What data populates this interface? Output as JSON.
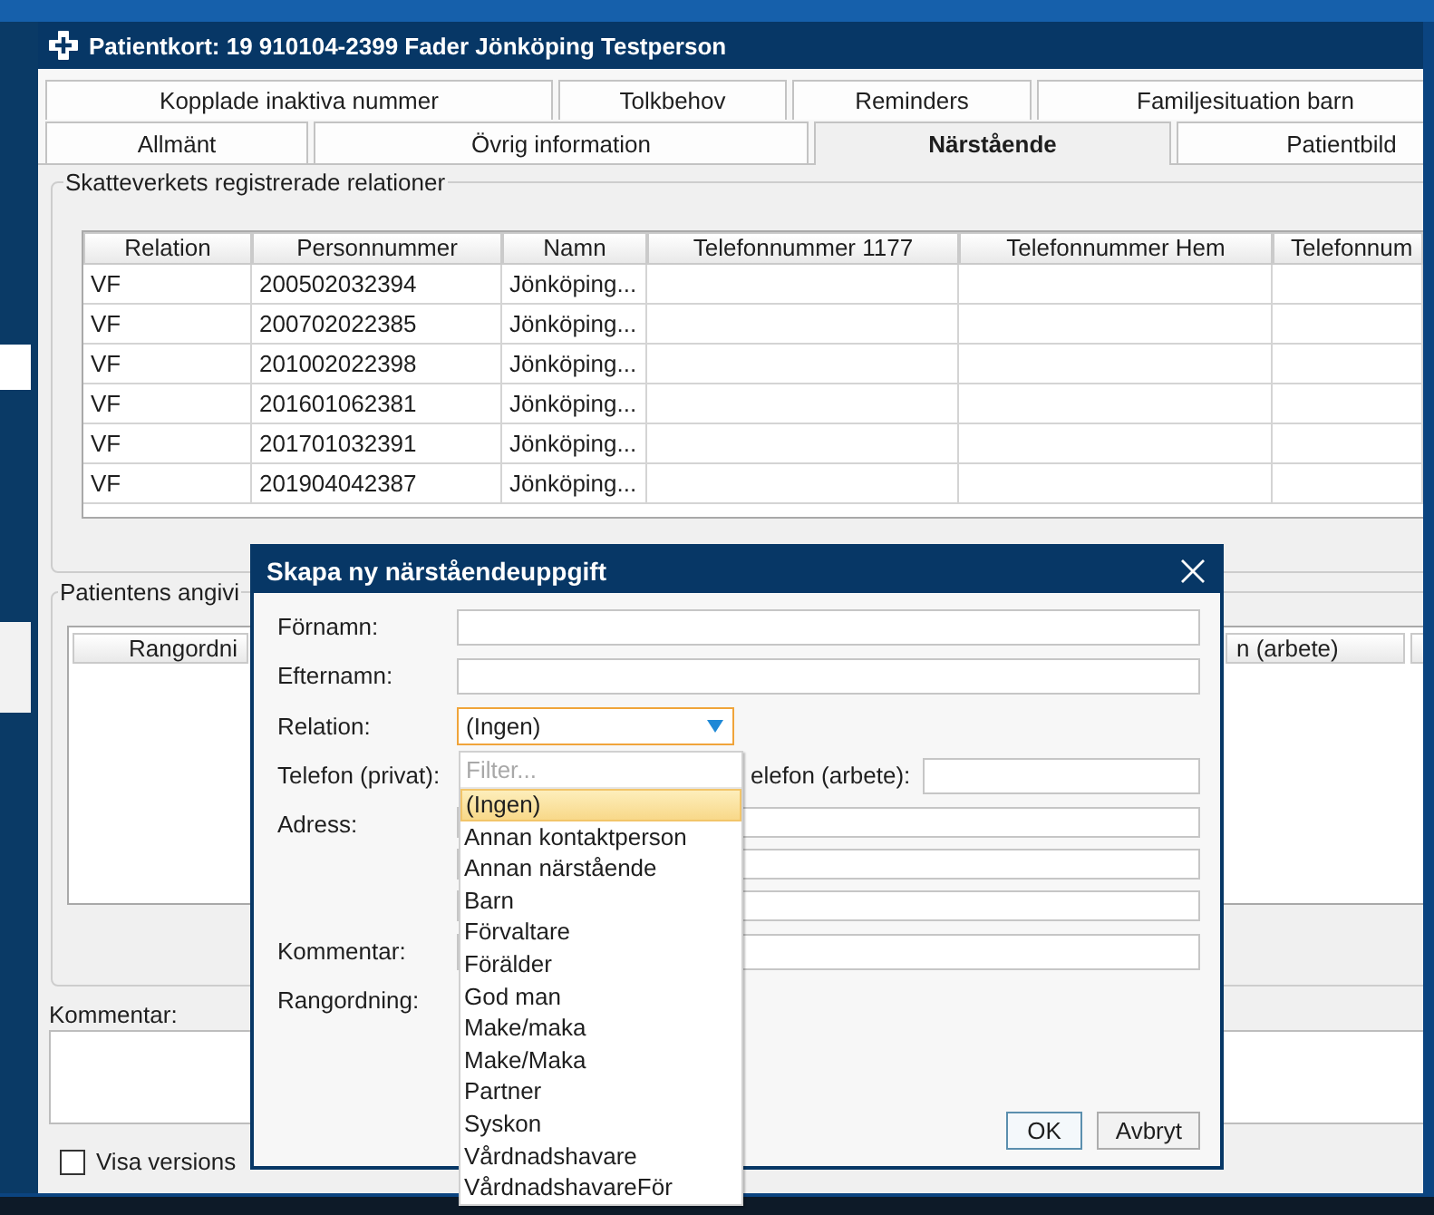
{
  "window": {
    "title": "Patientkort: 19 910104-2399 Fader Jönköping Testperson"
  },
  "tab_rows": [
    [
      {
        "label": "Kopplade inaktiva nummer",
        "selected": false
      },
      {
        "label": "Tolkbehov",
        "selected": false
      },
      {
        "label": "Reminders",
        "selected": false
      },
      {
        "label": "Familjesituation barn",
        "selected": false
      }
    ],
    [
      {
        "label": "Allmänt",
        "selected": false
      },
      {
        "label": "Övrig information",
        "selected": false
      },
      {
        "label": "Närstående",
        "selected": true
      },
      {
        "label": "Patientbild",
        "selected": false
      }
    ]
  ],
  "registered_relations": {
    "legend": "Skatteverkets registrerade relationer",
    "columns": [
      "Relation",
      "Personnummer",
      "Namn",
      "Telefonnummer 1177",
      "Telefonnummer Hem",
      "Telefonnum"
    ],
    "rows": [
      [
        "VF",
        "200502032394",
        "Jönköping..."
      ],
      [
        "VF",
        "200702022385",
        "Jönköping..."
      ],
      [
        "VF",
        "201002022398",
        "Jönköping..."
      ],
      [
        "VF",
        "201601062381",
        "Jönköping..."
      ],
      [
        "VF",
        "201701032391",
        "Jönköping..."
      ],
      [
        "VF",
        "201904042387",
        "Jönköping..."
      ]
    ]
  },
  "stated_relations": {
    "legend": "Patientens angivi",
    "columns": [
      "Rangordni",
      "n (arbete)"
    ]
  },
  "comment": {
    "label": "Kommentar:"
  },
  "show_history": {
    "label": "Visa versions",
    "checked": false
  },
  "dialog": {
    "title": "Skapa ny närståendeuppgift",
    "fields": [
      {
        "kind": "text",
        "label": "Förnamn:"
      },
      {
        "kind": "text",
        "label": "Efternamn:"
      },
      {
        "kind": "combo",
        "label": "Relation:",
        "value": "(Ingen)"
      },
      {
        "kind": "phone",
        "label": "Telefon (privat):",
        "second_label": "elefon (arbete):"
      },
      {
        "kind": "address",
        "label": "Adress:"
      },
      {
        "kind": "text",
        "label": "Kommentar:"
      },
      {
        "kind": "label",
        "label": "Rangordning:"
      }
    ],
    "dropdown": {
      "placeholder": "Filter...",
      "options": [
        {
          "label": "(Ingen)",
          "selected": true
        },
        {
          "label": "Annan kontaktperson",
          "selected": false
        },
        {
          "label": "Annan närstående",
          "selected": false
        },
        {
          "label": "Barn",
          "selected": false
        },
        {
          "label": "Förvaltare",
          "selected": false
        },
        {
          "label": "Förälder",
          "selected": false
        },
        {
          "label": "God man",
          "selected": false
        },
        {
          "label": "Make/maka",
          "selected": false
        },
        {
          "label": "Make/Maka",
          "selected": false
        },
        {
          "label": "Partner",
          "selected": false
        },
        {
          "label": "Syskon",
          "selected": false
        },
        {
          "label": "Vårdnadshavare",
          "selected": false
        },
        {
          "label": "VårdnadshavareFör",
          "selected": false
        }
      ]
    },
    "buttons": [
      {
        "label": "OK",
        "default": true
      },
      {
        "label": "Avbryt",
        "default": false
      }
    ]
  }
}
